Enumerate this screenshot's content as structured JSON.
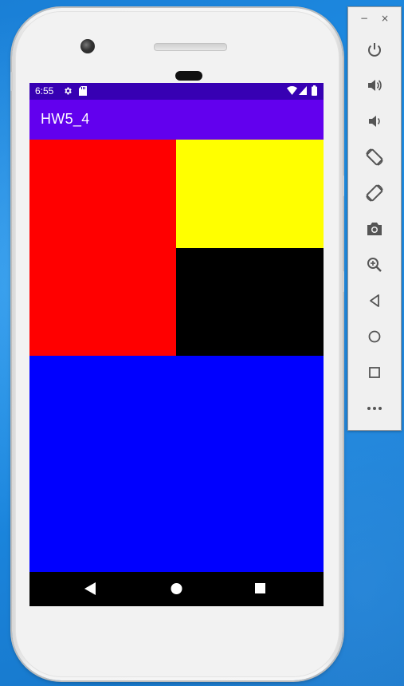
{
  "status_bar": {
    "time": "6:55",
    "icons": [
      "settings-icon",
      "sd-card-icon",
      "wifi-icon",
      "signal-icon",
      "battery-icon"
    ]
  },
  "app": {
    "title": "HW5_4"
  },
  "colors": {
    "status_bar": "#3700b3",
    "app_bar": "#6200ee",
    "red_block": "#ff0000",
    "yellow_block": "#ffff00",
    "black_block": "#000000",
    "blue_block": "#0000ff"
  },
  "nav_bar": {
    "buttons": [
      "back-icon",
      "home-icon",
      "recents-icon"
    ]
  },
  "tool_panel": {
    "window_controls": {
      "minimize": "−",
      "close": "×"
    },
    "tools": [
      "power-icon",
      "volume-up-icon",
      "volume-down-icon",
      "rotate-left-icon",
      "rotate-right-icon",
      "camera-icon",
      "zoom-icon",
      "back-icon",
      "home-icon",
      "overview-icon",
      "more-icon"
    ]
  }
}
